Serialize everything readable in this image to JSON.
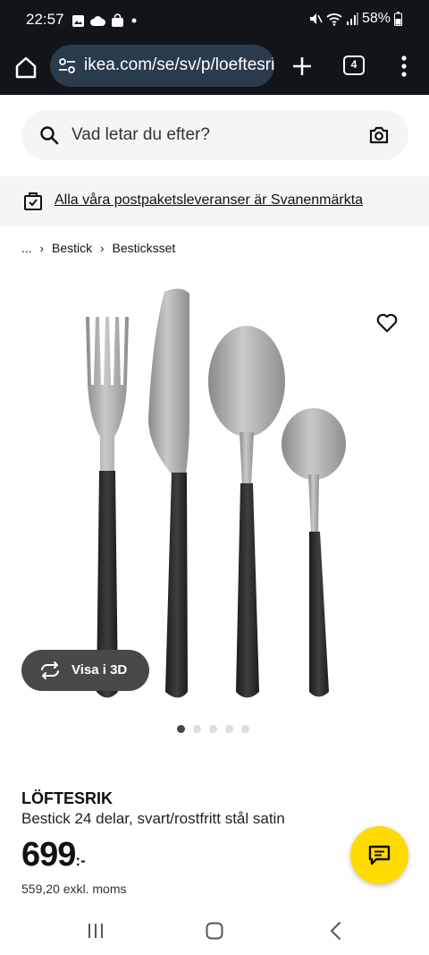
{
  "status_bar": {
    "time": "22:57",
    "battery": "58%",
    "icons": [
      "gallery-icon",
      "cloud-icon",
      "bag-icon",
      "dot-icon",
      "mute-icon",
      "wifi-icon",
      "signal-icon",
      "battery-icon"
    ]
  },
  "browser": {
    "url": "ikea.com/se/sv/p/loeftesrik",
    "tab_count": "4"
  },
  "search": {
    "placeholder": "Vad letar du efter?"
  },
  "banner": {
    "text": "Alla våra postpaketsleveranser är Svanenmärkta"
  },
  "breadcrumb": {
    "ellipsis": "...",
    "items": [
      "Bestick",
      "Besticksset"
    ]
  },
  "gallery": {
    "view_3d_label": "Visa i 3D",
    "image_count": 5,
    "active_index": 0
  },
  "product": {
    "name": "LÖFTESRIK",
    "description": "Bestick 24 delar, svart/rostfritt stål satin",
    "price": "699",
    "price_suffix": ":-",
    "price_ex_vat": "559,20 exkl. moms"
  },
  "colors": {
    "browser_bar": "#111418",
    "url_field": "#2a3b4c",
    "chat_button": "#ffdb00"
  }
}
